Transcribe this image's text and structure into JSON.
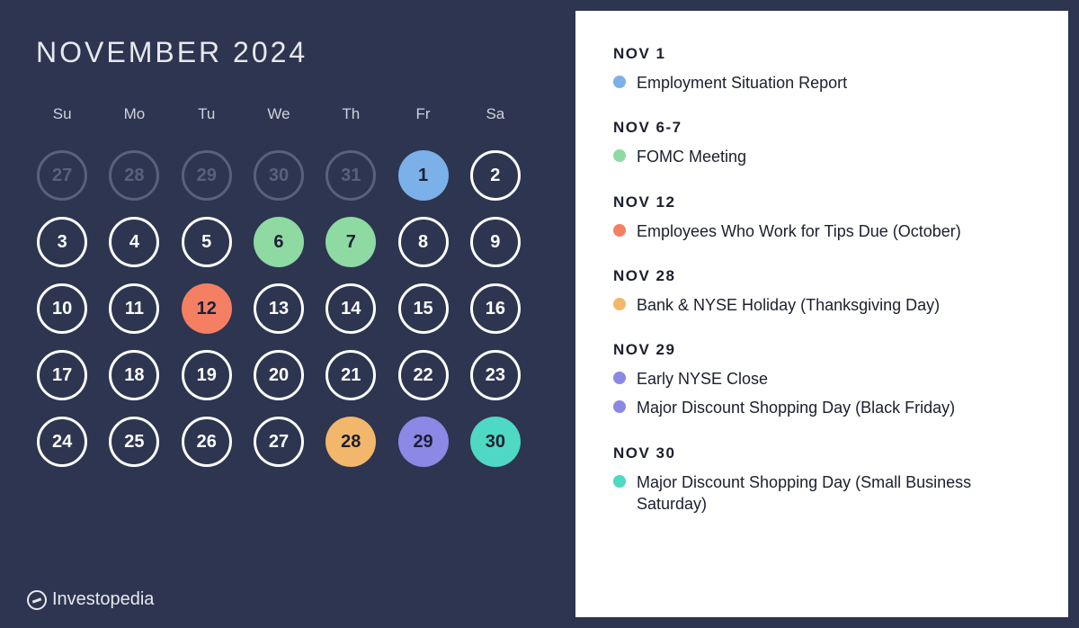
{
  "calendar": {
    "title": "NOVEMBER 2024",
    "dow": [
      "Su",
      "Mo",
      "Tu",
      "We",
      "Th",
      "Fr",
      "Sa"
    ],
    "days": [
      {
        "n": "27",
        "cls": "other"
      },
      {
        "n": "28",
        "cls": "other"
      },
      {
        "n": "29",
        "cls": "other"
      },
      {
        "n": "30",
        "cls": "other"
      },
      {
        "n": "31",
        "cls": "other"
      },
      {
        "n": "1",
        "cls": "ev-blue"
      },
      {
        "n": "2",
        "cls": "active"
      },
      {
        "n": "3",
        "cls": "active"
      },
      {
        "n": "4",
        "cls": "active"
      },
      {
        "n": "5",
        "cls": "active"
      },
      {
        "n": "6",
        "cls": "ev-green"
      },
      {
        "n": "7",
        "cls": "ev-green"
      },
      {
        "n": "8",
        "cls": "active"
      },
      {
        "n": "9",
        "cls": "active"
      },
      {
        "n": "10",
        "cls": "active"
      },
      {
        "n": "11",
        "cls": "active"
      },
      {
        "n": "12",
        "cls": "ev-orange"
      },
      {
        "n": "13",
        "cls": "active"
      },
      {
        "n": "14",
        "cls": "active"
      },
      {
        "n": "15",
        "cls": "active"
      },
      {
        "n": "16",
        "cls": "active"
      },
      {
        "n": "17",
        "cls": "active"
      },
      {
        "n": "18",
        "cls": "active"
      },
      {
        "n": "19",
        "cls": "active"
      },
      {
        "n": "20",
        "cls": "active"
      },
      {
        "n": "21",
        "cls": "active"
      },
      {
        "n": "22",
        "cls": "active"
      },
      {
        "n": "23",
        "cls": "active"
      },
      {
        "n": "24",
        "cls": "active"
      },
      {
        "n": "25",
        "cls": "active"
      },
      {
        "n": "26",
        "cls": "active"
      },
      {
        "n": "27",
        "cls": "active"
      },
      {
        "n": "28",
        "cls": "ev-peach"
      },
      {
        "n": "29",
        "cls": "ev-purple"
      },
      {
        "n": "30",
        "cls": "ev-teal"
      }
    ]
  },
  "events": [
    {
      "date": "NOV 1",
      "items": [
        {
          "dot": "blue",
          "text": "Employment Situation Report"
        }
      ]
    },
    {
      "date": "NOV 6-7",
      "items": [
        {
          "dot": "green",
          "text": "FOMC Meeting"
        }
      ]
    },
    {
      "date": "NOV 12",
      "items": [
        {
          "dot": "orange",
          "text": "Employees Who Work for Tips Due (October)"
        }
      ]
    },
    {
      "date": "NOV 28",
      "items": [
        {
          "dot": "peach",
          "text": "Bank & NYSE Holiday (Thanksgiving Day)"
        }
      ]
    },
    {
      "date": "NOV 29",
      "items": [
        {
          "dot": "purple",
          "text": "Early NYSE Close"
        },
        {
          "dot": "purple",
          "text": "Major Discount Shopping Day (Black Friday)"
        }
      ]
    },
    {
      "date": "NOV 30",
      "items": [
        {
          "dot": "teal",
          "text": "Major Discount Shopping Day (Small Business Saturday)"
        }
      ]
    }
  ],
  "brand": "Investopedia"
}
